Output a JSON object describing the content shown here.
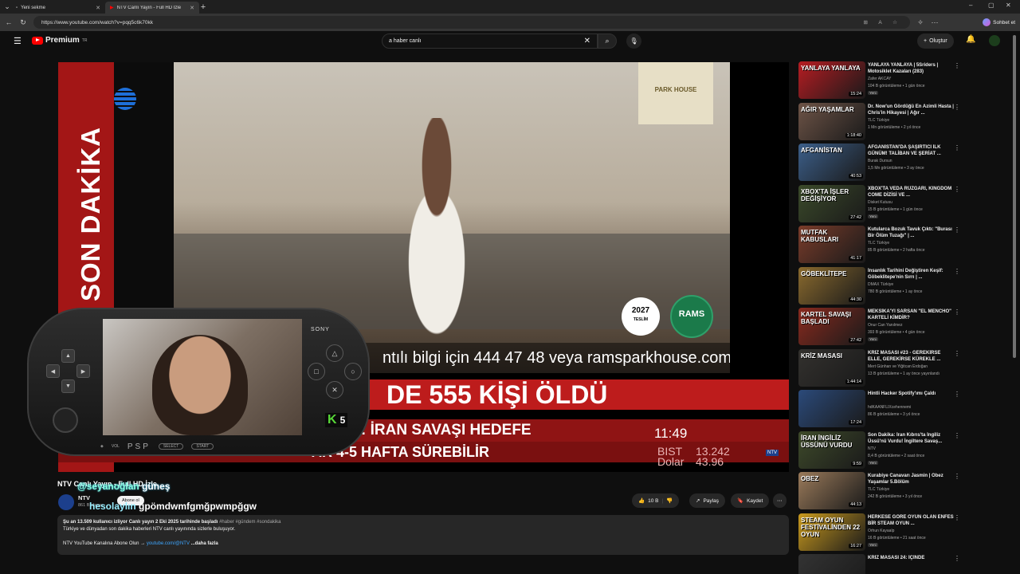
{
  "browser": {
    "tabs": [
      {
        "title": "Yeni sekme",
        "active": false
      },
      {
        "title": "NTV Canlı Yayın - Full HD İzle",
        "active": true
      }
    ],
    "url": "https://www.youtube.com/watch?v=pqq5c6k70kk",
    "chat_label": "Sohbet et"
  },
  "header": {
    "logo_text": "Premium",
    "logo_region": "TR",
    "search_value": "a haber canlı",
    "create_label": "Oluştur"
  },
  "player": {
    "side_banner": "SON DAKİKA",
    "sponsor_badge": "PARK HOUSE",
    "badge_year": "2027",
    "badge_year_sub": "TESLİM",
    "rams_badge": "RAMS",
    "ad_info": "ntılı bilgi için 444 47 48 veya ramsparkhouse.com",
    "headline": "DE 555 KİŞİ ÖLDÜ",
    "ticker1": ": İRAN SAVAŞI HEDEFE",
    "ticker2": "AR 4-5 HAFTA SÜREBİLİR",
    "clock": "11:49",
    "bist_label": "BIST",
    "bist_value": "13.242",
    "dolar_label": "Dolar",
    "dolar_value": "43.96",
    "channel_mini": "NTV"
  },
  "psp": {
    "brand": "SONY",
    "logo": "PSP",
    "vol": "VOL",
    "select": "SELECT",
    "start": "START",
    "k_badge_letter": "K",
    "k_badge_number": "5"
  },
  "video": {
    "title": "NTV Canlı Yayın - Full HD İzle",
    "channel": "NTV",
    "subs": "861 B abone",
    "subscribe": "Abone ol",
    "likes": "10 B",
    "share": "Paylaş",
    "save": "Kaydet",
    "desc_line1": "Şu an 13.509 kullanıcı izliyor  Canlı yayın 2 Eki 2025 tarihinde başladı",
    "desc_tags": "#haber #gündem #sondakika",
    "desc_line2": "Türkiye ve dünyadan son dakika haberleri NTV canlı yayınında sizlerle buluşuyor.",
    "desc_line3": "NTV YouTube Kanalına Abone Olun →",
    "desc_link": "youtube.com/@NTV",
    "desc_more": "...daha fazla"
  },
  "overlay_chat": {
    "line1_name": "@seyanoğlan",
    "line1_text": "güneş",
    "line2_name": "hesolaylın",
    "line2_text": "ğpömdwmfgmğpwmpğgw"
  },
  "recommendations": [
    {
      "title": "YANLAYA YANLAYA | 5Sriders | Motosiklet Kazaları (283)",
      "channel": "Zafer AKCAY",
      "meta": "104 B görüntüleme • 1 gün önce",
      "duration": "15:24",
      "badge": "Yeni",
      "thumb_text": "YANLAYA YANLAYA",
      "color": "#b61c22"
    },
    {
      "title": "Dr. Now'un Gördüğü En Azimli Hasta | Chris'in Hikayesi | Ağır ...",
      "channel": "TLC Türkiye",
      "meta": "1 Mn görüntüleme • 2 yıl önce",
      "duration": "1:18:40",
      "badge": "",
      "thumb_text": "AĞIR YAŞAMLAR",
      "color": "#6e5447"
    },
    {
      "title": "AFGANİSTAN'DA ŞAŞIRTICI İLK GÜNÜM! TALİBAN VE ŞERİAT ...",
      "channel": "Burak Dursun",
      "meta": "1,5 Mn görüntüleme • 3 ay önce",
      "duration": "40:53",
      "badge": "",
      "thumb_text": "AFGANİSTAN",
      "color": "#3c5f8a"
    },
    {
      "title": "XBOX'TA VEDA RÜZGARI, KINGDOM COME DİZİSİ VE ...",
      "channel": "Disket Kutusu",
      "meta": "15 B görüntüleme • 1 gün önce",
      "duration": "27:42",
      "badge": "Yeni",
      "thumb_text": "XBOX'TA İŞLER DEĞİŞİYOR",
      "color": "#3b4a2a"
    },
    {
      "title": "Kutularca Bozuk Tavuk Çıktı: \"Burası Bir Ölüm Tuzağı\" | ...",
      "channel": "TLC Türkiye",
      "meta": "85 B görüntüleme • 2 hafta önce",
      "duration": "41:17",
      "badge": "",
      "thumb_text": "MUTFAK KABUSLARI",
      "color": "#7a3c2a"
    },
    {
      "title": "İnsanlık Tarihini Değiştiren Keşif: Göbeklitepe'nin Sırrı | ...",
      "channel": "DMAX Türkiye",
      "meta": "780 B görüntüleme • 1 ay önce",
      "duration": "44:30",
      "badge": "",
      "thumb_text": "GÖBEKLİTEPE",
      "color": "#8a6a2e"
    },
    {
      "title": "MEKSİKA'YI SARSAN \"EL MENCHO\" KARTELİ KİMDİR?",
      "channel": "Onur Can Yanılmez",
      "meta": "393 B görüntüleme • 4 gün önce",
      "duration": "27:42",
      "badge": "Yeni",
      "thumb_text": "KARTEL SAVAŞI BAŞLADI",
      "color": "#8a2a1e"
    },
    {
      "title": "KRİZ MASASI #23 - GEREKİRSE ELLE, GEREKİRSE KÜREKLE ...",
      "channel": "Mert Günhan ve Yiğitcan Erdoğan",
      "meta": "13 B görüntüleme • 1 ay önce yayınlandı",
      "duration": "1:44:14",
      "badge": "",
      "thumb_text": "KRİZ MASASI",
      "color": "#33312e"
    },
    {
      "title": "Hintli Hacker Spotify'ımı Çaldı",
      "channel": "hdKAANFLIXcehennemi",
      "meta": "86 B görüntüleme • 3 yıl önce",
      "duration": "17:24",
      "badge": "",
      "thumb_text": "",
      "color": "#2b4a7a"
    },
    {
      "title": "Son Dakika: İran Kıbrıs'ta İngiliz Üssü'nü Vurdu! İngiltere Savaş...",
      "channel": "NTV",
      "meta": "8,4 B görüntüleme • 2 saat önce",
      "duration": "9:59",
      "badge": "Yeni",
      "thumb_text": "İRAN İNGİLİZ ÜSSÜNÜ VURDU",
      "color": "#3e4a2a"
    },
    {
      "title": "Kurabiye Canavarı Jasmin | Obez Yaşamlar 5.Bölüm",
      "channel": "TLC Türkiye",
      "meta": "242 B görüntüleme • 3 yıl önce",
      "duration": "44:13",
      "badge": "",
      "thumb_text": "OBEZ",
      "color": "#9a7a5a"
    },
    {
      "title": "HERKESE GÖRE OYUN OLAN ENFES BİR STEAM OYUN ...",
      "channel": "Orhun Kayaalp",
      "meta": "16 B görüntüleme • 21 saat önce",
      "duration": "16:27",
      "badge": "Yeni",
      "thumb_text": "STEAM OYUN FESTİVALİNDEN 22 OYUN",
      "color": "#c99a1e"
    },
    {
      "title": "KRİZ MASASI 24: İÇİNDE",
      "channel": "",
      "meta": "",
      "duration": "",
      "badge": "",
      "thumb_text": "",
      "color": "#333"
    }
  ]
}
